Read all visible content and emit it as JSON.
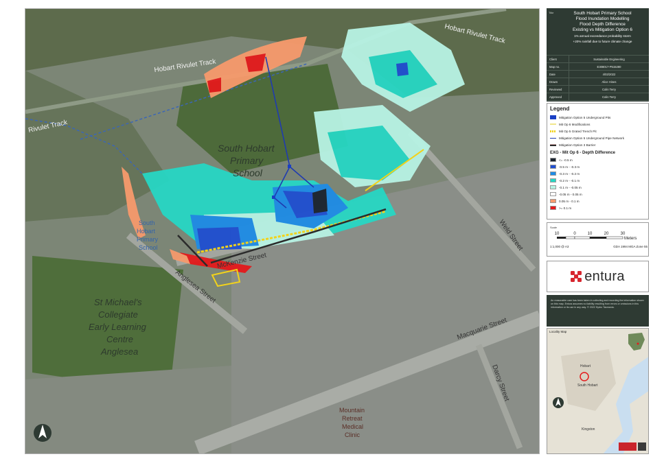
{
  "title_block": {
    "tag": "Title",
    "project": "South Hobart Primary School",
    "title_lines": [
      "Flood Inundation Modelling",
      "Flood Depth Difference",
      "Existing vs Mitigation Option 6"
    ],
    "subtitle_lines": [
      "1% annual exceedance probability storm",
      "+20% rainfall due to future climate change"
    ]
  },
  "info_table": [
    {
      "key": "Client",
      "value": "Sustainable Engineering"
    },
    {
      "key": "Map no.",
      "value": "E308017-P515280"
    },
    {
      "key": "Date",
      "value": "4/02/2022"
    },
    {
      "key": "Drawn",
      "value": "Alice Hines"
    },
    {
      "key": "Reviewed",
      "value": "Colin Terry"
    },
    {
      "key": "Approved",
      "value": "Colin Terry"
    }
  ],
  "legend": {
    "title": "Legend",
    "items": [
      {
        "label": "Mitigation Option 5 Underground Pits",
        "color": "#1a3fc4",
        "kind": "box"
      },
      {
        "label": "Mit Op 6 Modifications",
        "color": "#f0e68c",
        "kind": "line"
      },
      {
        "label": "Mit Op 5 Grated Trench Pit",
        "color": "#f2d21b",
        "kind": "dash"
      },
      {
        "label": "Mitigation Option 5 Underground Pipe Network",
        "color": "#1f3bb0",
        "kind": "thin"
      },
      {
        "label": "Mitigation Option 3 Barrier",
        "color": "#5a2a2a",
        "kind": "barrier"
      }
    ],
    "depth_title": "EXG - Mit Op 6 - Depth Difference",
    "depth_classes": [
      {
        "label": "<= -0.5 m",
        "color": "#1b2430"
      },
      {
        "label": "-0.5 m - -0.3 m",
        "color": "#1f4fd1"
      },
      {
        "label": "-0.3 m - -0.2 m",
        "color": "#1e8ce6"
      },
      {
        "label": "-0.2 m - -0.1 m",
        "color": "#27d7c4"
      },
      {
        "label": "-0.1 m - -0.05 m",
        "color": "#b8f3e4"
      },
      {
        "label": "-0.05 m - 0.05 m",
        "color": "#ffffff"
      },
      {
        "label": "0.05 m - 0.1 m",
        "color": "#f79a6c"
      },
      {
        "label": ">= 0.1 m",
        "color": "#e41a1c"
      }
    ]
  },
  "scale": {
    "label": "Scale",
    "ticks": [
      "10",
      "0",
      "10",
      "20",
      "30"
    ],
    "unit": "Meters",
    "ratio": "1:1,000 @ A3",
    "projection": "GDA 1994 MGA Zone 55"
  },
  "logo": {
    "text": "entura",
    "color": "#d7262e"
  },
  "disclaimer": "An reasonable care has been taken in collecting and recording the information shown on this map. Entura assumes no liability resulting from errors or omissions in this information or its use in any way. © 2022 Hydro Tasmania.",
  "locality": {
    "title": "Locality Map",
    "places": [
      "Hobart",
      "South Hobart",
      "Kingston"
    ]
  },
  "map_labels": {
    "rivulet_track_ne": "Hobart Rivulet Track",
    "rivulet_track_n": "Hobart Rivulet Track",
    "rivulet_track_w": "Rivulet Track",
    "school_big": [
      "South Hobart",
      "Primary",
      "School"
    ],
    "school_small": [
      "South",
      "Hobart",
      "Primary",
      "School"
    ],
    "st_michaels": [
      "St Michael's",
      "Collegiate",
      "Early Learning",
      "Centre",
      "Anglesea"
    ],
    "mckenzie": "McKenzie Street",
    "anglesea": "Anglesea Street",
    "weld": "Weld Street",
    "macquarie": "Macquarie Street",
    "darcy": "Darcy Street",
    "medical": [
      "Mountain",
      "Retreat",
      "Medical",
      "Clinic"
    ]
  },
  "colors": {
    "panel_dark": "#2e3a33",
    "aerial": "#6f7a6c"
  }
}
